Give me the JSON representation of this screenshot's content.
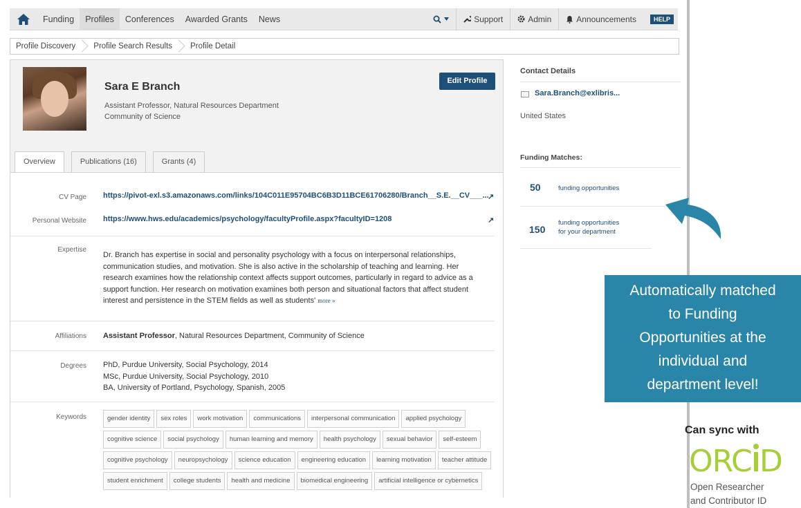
{
  "nav": {
    "items": [
      {
        "label": "Funding",
        "active": false
      },
      {
        "label": "Profiles",
        "active": true
      },
      {
        "label": "Conferences",
        "active": false
      },
      {
        "label": "Awarded Grants",
        "active": false
      },
      {
        "label": "News",
        "active": false
      }
    ],
    "support": "Support",
    "admin": "Admin",
    "announcements": "Announcements",
    "help": "HELP",
    "icons": {
      "home": "home-icon",
      "search": "search-icon",
      "support": "wrench-icon",
      "admin": "gear-icon",
      "announcements": "bell-icon"
    }
  },
  "breadcrumb": [
    "Profile Discovery",
    "Profile Search Results",
    "Profile Detail"
  ],
  "profile": {
    "name": "Sara E Branch",
    "position": "Assistant Professor, Natural Resources Department",
    "organization": "Community of Science",
    "edit_label": "Edit Profile"
  },
  "tabs": [
    {
      "label": "Overview",
      "active": true
    },
    {
      "label": "Publications (16)",
      "active": false
    },
    {
      "label": "Grants (4)",
      "active": false
    }
  ],
  "details": {
    "cv_label": "CV Page",
    "cv_url": "https://pivot-exl.s3.amazonaws.com/links/104C011E95704BC6B3D11BCE61706280/Branch__S.E.__CV___...",
    "website_label": "Personal Website",
    "website_url": "https://www.hws.edu/academics/psychology/facultyProfile.aspx?facultyID=1208",
    "expertise_label": "Expertise",
    "expertise_lines": [
      "Dr. Branch has expertise in social and personality psychology with a focus on interpersonal relationships,",
      "communication studies, and motivation. She is also active in the scholarship of teaching and learning. Her",
      "research examines how the relationship context affects support outcomes, particularly in regard to advice as a",
      "support function. Her research on motivation examines both person and situational factors that affect student",
      "interest and persistence in the STEM fields as well as students'"
    ],
    "more_label": "more »",
    "affiliations_label": "Affiliations",
    "affiliation_title": "Assistant Professor",
    "affiliation_rest": ", Natural Resources Department, Community of Science",
    "degrees_label": "Degrees",
    "degrees": [
      "PhD, Purdue University, Social Psychology, 2014",
      "MSc, Purdue University, Social Psychology, 2010",
      "BA, University of Portland, Psychology, Spanish, 2005"
    ],
    "keywords_label": "Keywords",
    "keyword_rows": [
      [
        "gender identity",
        "sex roles",
        "work motivation",
        "communications",
        "interpersonal communication",
        "applied psychology"
      ],
      [
        "cognitive science",
        "social psychology",
        "human learning and memory",
        "health psychology",
        "sexual behavior",
        "self-esteem"
      ],
      [
        "cognitive psychology",
        "neuropsychology",
        "science education",
        "engineering education",
        "learning motivation",
        "teacher attitude"
      ],
      [
        "student enrichment",
        "college students",
        "health and medicine",
        "biomedical engineering",
        "artificial intelligence or cybernetics"
      ]
    ]
  },
  "sidebar": {
    "contact_title": "Contact Details",
    "email": "Sara.Branch@exlibris...",
    "country": "United States",
    "funding_title": "Funding Matches:",
    "match1_num": "50",
    "match1_text": "funding opportunities",
    "match2_num": "150",
    "match2_text1": "funding opportunities",
    "match2_text2": "for your department"
  },
  "callout": {
    "lines": [
      "Automatically matched",
      "to Funding",
      "Opportunities at the",
      "individual and",
      "department level!"
    ],
    "color": "#2a86a8"
  },
  "orcid": {
    "sync_text": "Can sync with",
    "logo_text": "ORCiD",
    "sub_line1": "Open Researcher",
    "sub_line2": "and Contributor ID",
    "color": "#a6ce39"
  }
}
